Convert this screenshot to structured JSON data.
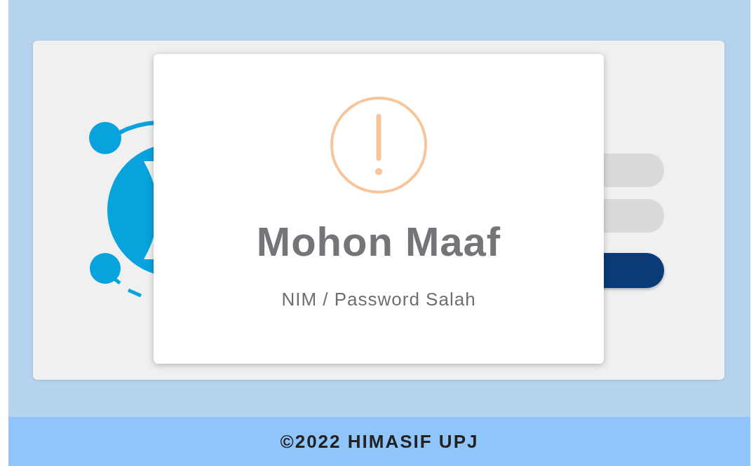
{
  "alert": {
    "title": "Mohon Maaf",
    "message": "NIM / Password Salah"
  },
  "footer": {
    "text": "©2022 HIMASIF UPJ"
  }
}
